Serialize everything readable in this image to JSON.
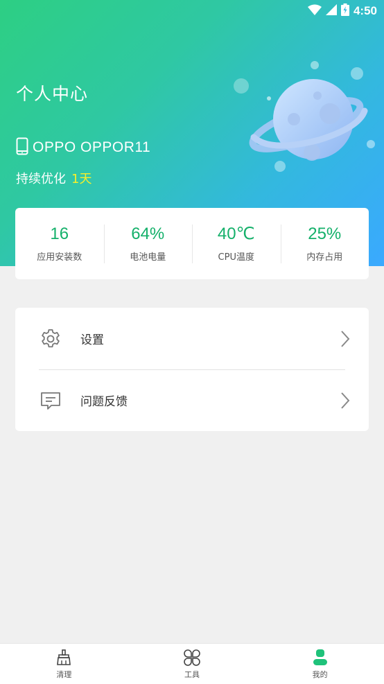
{
  "status_bar": {
    "time": "4:50",
    "icons": [
      "wifi-icon",
      "signal-icon",
      "battery-icon"
    ]
  },
  "header": {
    "title": "个人中心",
    "device_name": "OPPO  OPPOR11",
    "optimize_label": "持续优化",
    "optimize_days": "1天",
    "colors": {
      "gradient_start": "#2dcf83",
      "gradient_end": "#3aa9ff",
      "days_highlight": "#f7f02a"
    }
  },
  "stats": [
    {
      "value": "16",
      "label": "应用安装数"
    },
    {
      "value": "64%",
      "label": "电池电量"
    },
    {
      "value": "40℃",
      "label": "CPU温度"
    },
    {
      "value": "25%",
      "label": "内存占用"
    }
  ],
  "stats_color": "#14b06a",
  "menu": {
    "items": [
      {
        "label": "设置",
        "icon": "gear-icon"
      },
      {
        "label": "问题反馈",
        "icon": "feedback-icon"
      }
    ]
  },
  "bottom_nav": {
    "items": [
      {
        "label": "清理",
        "icon": "broom-icon",
        "active": false
      },
      {
        "label": "工具",
        "icon": "tools-icon",
        "active": false
      },
      {
        "label": "我的",
        "icon": "user-icon",
        "active": true
      }
    ],
    "active_color": "#1fc27a"
  }
}
